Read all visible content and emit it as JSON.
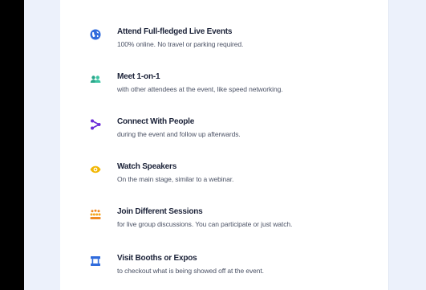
{
  "colors": {
    "page_background": "#000000",
    "side_panel": "#ecf1fb",
    "card": "#ffffff",
    "title_text": "#1b2238",
    "desc_text": "#4c5366",
    "blue_icon": "#2f6bdc",
    "teal_icon": "#2aa68a",
    "purple_icon": "#6c2bd9",
    "yellow_icon": "#f2b705",
    "orange_icon": "#f08a24"
  },
  "features": [
    {
      "icon": "globe-icon",
      "title": "Attend Full-fledged Live Events",
      "description": "100% online. No travel or parking required."
    },
    {
      "icon": "people-icon",
      "title": "Meet 1-on-1",
      "description": "with other attendees at the event, like speed networking."
    },
    {
      "icon": "connect-icon",
      "title": "Connect With People",
      "description": "during the event and follow up afterwards."
    },
    {
      "icon": "eye-icon",
      "title": "Watch Speakers",
      "description": "On the main stage, similar to a webinar."
    },
    {
      "icon": "group-icon",
      "title": "Join Different Sessions",
      "description": "for live group discussions. You can participate or just watch."
    },
    {
      "icon": "booth-icon",
      "title": "Visit Booths or Expos",
      "description": "to checkout what is being showed off at the event."
    }
  ]
}
